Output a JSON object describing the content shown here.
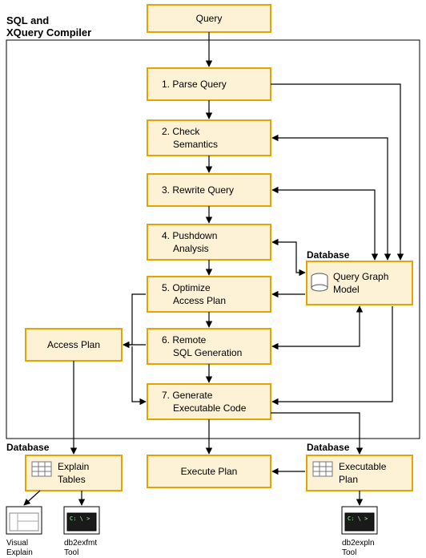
{
  "title_line1": "SQL and",
  "title_line2": "XQuery Compiler",
  "db_label": "Database",
  "nodes": {
    "query": "Query",
    "s1_a": "1. Parse Query",
    "s2_a": "2. Check",
    "s2_b": "Semantics",
    "s3_a": "3. Rewrite Query",
    "s4_a": "4. Pushdown",
    "s4_b": "Analysis",
    "s5_a": "5. Optimize",
    "s5_b": "Access Plan",
    "s6_a": "6. Remote",
    "s6_b": "SQL Generation",
    "s7_a": "7. Generate",
    "s7_b": "Executable Code",
    "access_plan": "Access Plan",
    "qgm_a": "Query Graph",
    "qgm_b": "Model",
    "explain_a": "Explain",
    "explain_b": "Tables",
    "execute_plan": "Execute Plan",
    "exec_plan_a": "Executable",
    "exec_plan_b": "Plan"
  },
  "tools": {
    "visual_a": "Visual",
    "visual_b": "Explain",
    "db2exfmt_a": "db2exfmt",
    "db2exfmt_b": "Tool",
    "db2expln_a": "db2expln",
    "db2expln_b": "Tool",
    "prompt": "C: \\ >"
  }
}
